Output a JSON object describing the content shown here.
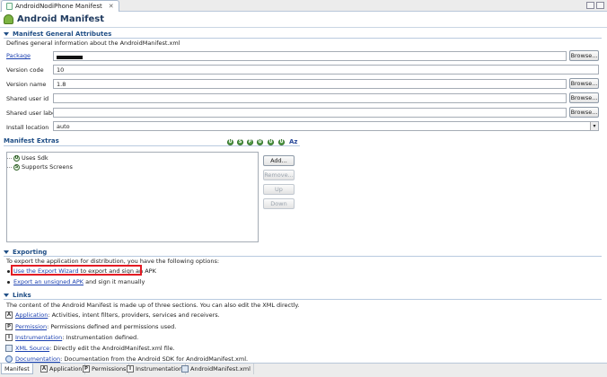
{
  "editor_tab": {
    "label": "AndroidNodiPhone Manifest",
    "close": "✕"
  },
  "title": "Android Manifest",
  "general": {
    "header": "Manifest General Attributes",
    "description": "Defines general information about the AndroidManifest.xml",
    "fields": [
      {
        "label": "Package",
        "value": "",
        "redacted": true,
        "has_browse": true
      },
      {
        "label": "Version code",
        "value": "10",
        "has_browse": false
      },
      {
        "label": "Version name",
        "value": "1.8",
        "has_browse": true
      },
      {
        "label": "Shared user id",
        "value": "",
        "has_browse": true
      },
      {
        "label": "Shared user label",
        "value": "",
        "has_browse": true
      },
      {
        "label": "Install location",
        "value": "auto",
        "is_select": true
      }
    ],
    "browse_label": "Browse..."
  },
  "extras": {
    "header": "Manifest Extras",
    "toolbar_icons": [
      "U",
      "S",
      "P",
      "U",
      "U",
      "U"
    ],
    "sort_label": "Az",
    "items": [
      {
        "badge": "U",
        "label": "Uses Sdk"
      },
      {
        "badge": "S",
        "label": "Supports Screens"
      }
    ],
    "buttons": {
      "add": "Add...",
      "remove": "Remove...",
      "up": "Up",
      "down": "Down"
    }
  },
  "exporting": {
    "header": "Exporting",
    "intro": "To export the application for distribution, you have the following options:",
    "option1_link": "Use the Export Wizard",
    "option1_text": " to export and sign an APK",
    "option2_link": "Export an unsigned APK",
    "option2_text": " and sign it manually"
  },
  "links": {
    "header": "Links",
    "intro": "The content of the Android Manifest is made up of three sections. You can also edit the XML directly.",
    "rows": [
      {
        "icon": "A",
        "link": "Application",
        "text": ": Activities, intent filters, providers, services and receivers."
      },
      {
        "icon": "P",
        "link": "Permission",
        "text": ": Permissions defined and permissions used."
      },
      {
        "icon": "I",
        "link": "Instrumentation",
        "text": ": Instrumentation defined."
      },
      {
        "icon": "xml",
        "link": "XML Source",
        "text": ": Directly edit the AndroidManifest.xml file."
      },
      {
        "icon": "doc",
        "link": "Documentation",
        "text": ": Documentation from the Android SDK for AndroidManifest.xml."
      }
    ]
  },
  "bottom_tabs": [
    {
      "label": "Manifest",
      "icon": "",
      "active": true
    },
    {
      "label": "Application",
      "icon": "A"
    },
    {
      "label": "Permissions",
      "icon": "P"
    },
    {
      "label": "Instrumentation",
      "icon": "I"
    },
    {
      "label": "AndroidManifest.xml",
      "icon": "xml"
    }
  ],
  "colors": {
    "link": "#1a3fb0",
    "section_header": "#1f4e86",
    "highlight": "#e31b23"
  }
}
